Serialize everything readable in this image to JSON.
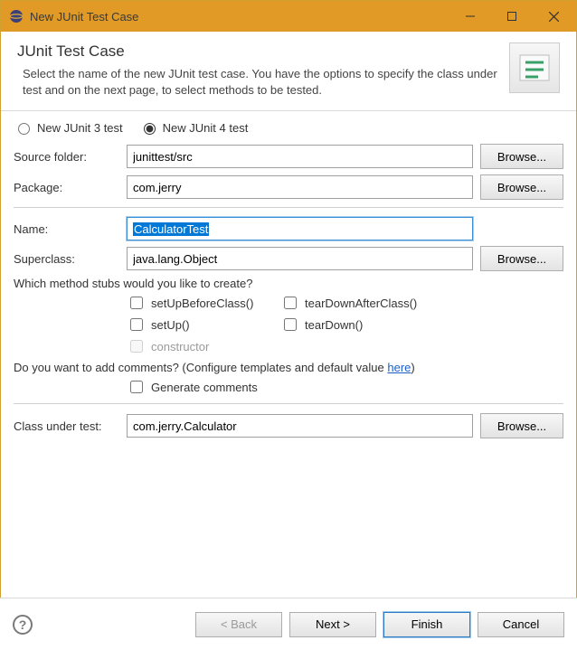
{
  "window": {
    "title": "New JUnit Test Case"
  },
  "banner": {
    "title": "JUnit Test Case",
    "description": "Select the name of the new JUnit test case. You have the options to specify the class under test and on the next page, to select methods to be tested."
  },
  "radios": {
    "junit3": "New JUnit 3 test",
    "junit4": "New JUnit 4 test",
    "selected": "junit4"
  },
  "fields": {
    "source_folder_label": "Source folder:",
    "source_folder_value": "junittest/src",
    "package_label": "Package:",
    "package_value": "com.jerry",
    "name_label": "Name:",
    "name_value": "CalculatorTest",
    "superclass_label": "Superclass:",
    "superclass_value": "java.lang.Object",
    "class_under_test_label": "Class under test:",
    "class_under_test_value": "com.jerry.Calculator"
  },
  "buttons": {
    "browse": "Browse...",
    "back": "< Back",
    "next": "Next >",
    "finish": "Finish",
    "cancel": "Cancel"
  },
  "stubs": {
    "question": "Which method stubs would you like to create?",
    "setUpBeforeClass": "setUpBeforeClass()",
    "tearDownAfterClass": "tearDownAfterClass()",
    "setUp": "setUp()",
    "tearDown": "tearDown()",
    "constructor": "constructor"
  },
  "comments": {
    "question_prefix": "Do you want to add comments? (Configure templates and default value ",
    "link": "here",
    "question_suffix": ")",
    "generate": "Generate comments"
  }
}
